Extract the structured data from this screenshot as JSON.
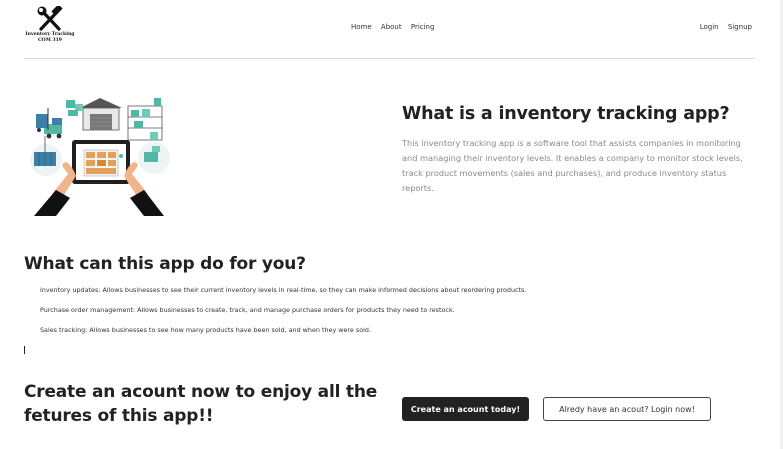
{
  "header": {
    "logo_line1": "Inventory Tracking",
    "logo_line2": "COM 319",
    "nav": [
      "Home",
      "About",
      "Pricing"
    ],
    "auth": [
      "Login",
      "Signup"
    ]
  },
  "hero": {
    "title": "What is a inventory tracking app?",
    "description": "This inventory tracking app is a software tool that assists companies in monitoring and managing their inventory levels. It enables a company to monitor stock levels, track product movements (sales and purchases), and produce inventory status reports."
  },
  "features": {
    "title": "What can this app do for you?",
    "items": [
      "inventory updates: Allows businesses to see their current inventory levels in real-time, so they can make informed decisions about reordering products.",
      "Purchase order management: Allows businesses to create, track, and manage purchase orders for products they need to restock.",
      "Sales tracking: Allows businesses to see how many products have been sold, and when they were sold."
    ]
  },
  "cta": {
    "title": "Create an acount now to enjoy all the fetures of this app!!",
    "primary_button": "Create an acount today!",
    "secondary_button": "Alredy have an acout? Login now!"
  },
  "icons": {
    "logo": "crossed-hammer-wrench-icon",
    "illustration": "warehouse-tablet-illustration"
  },
  "colors": {
    "accent": "#222222",
    "muted_text": "#8a8a8a",
    "teal": "#4fb7a6"
  }
}
